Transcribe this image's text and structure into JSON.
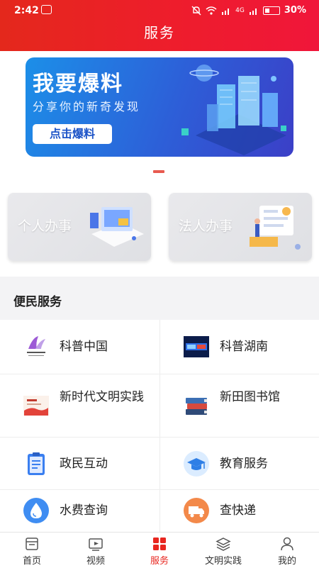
{
  "status_bar": {
    "time": "2:42",
    "battery": "30%",
    "signal_tag": "4G"
  },
  "header": {
    "title": "服务"
  },
  "banner": {
    "title": "我要爆料",
    "subtitle": "分享你的新奇发现",
    "button": "点击爆料"
  },
  "quick_actions": [
    {
      "label": "个人办事"
    },
    {
      "label": "法人办事"
    }
  ],
  "section": {
    "title": "便民服务"
  },
  "services": [
    {
      "label": "科普中国",
      "icon": "kepu-china-logo-icon"
    },
    {
      "label": "科普湖南",
      "icon": "kepu-hunan-logo-icon"
    },
    {
      "label": "新时代文明实践",
      "icon": "civilization-practice-icon"
    },
    {
      "label": "新田图书馆",
      "icon": "books-icon"
    },
    {
      "label": "政民互动",
      "icon": "clipboard-icon"
    },
    {
      "label": "教育服务",
      "icon": "graduation-cap-icon"
    },
    {
      "label": "水费查询",
      "icon": "water-drop-icon"
    },
    {
      "label": "查快递",
      "icon": "delivery-truck-icon"
    }
  ],
  "tabbar": {
    "active": "服务",
    "active_color": "#e8261f",
    "items": [
      {
        "label": "首页",
        "icon": "home-icon"
      },
      {
        "label": "视频",
        "icon": "video-icon"
      },
      {
        "label": "服务",
        "icon": "services-grid-icon"
      },
      {
        "label": "文明实践",
        "icon": "layers-icon"
      },
      {
        "label": "我的",
        "icon": "user-icon"
      }
    ]
  },
  "colors": {
    "header_red": "#ee1d2c",
    "banner_blue": "#2d5fd8",
    "accent": "#e8261f"
  }
}
